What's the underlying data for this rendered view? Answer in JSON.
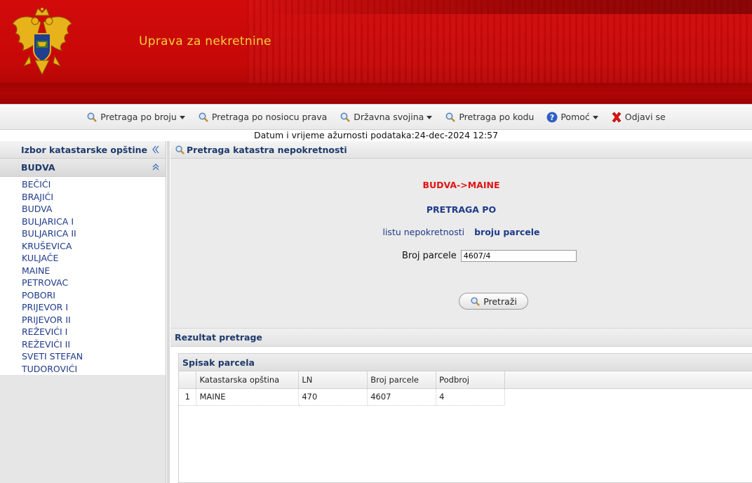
{
  "header": {
    "title": "Uprava za nekretnine"
  },
  "menu": {
    "items": [
      {
        "label": "Pretraga po broju",
        "icon": "search-icon",
        "dropdown": true
      },
      {
        "label": "Pretraga po nosiocu prava",
        "icon": "search-icon",
        "dropdown": false
      },
      {
        "label": "Državna svojina",
        "icon": "search-icon",
        "dropdown": true
      },
      {
        "label": "Pretraga po kodu",
        "icon": "search-icon",
        "dropdown": false
      },
      {
        "label": "Pomoć",
        "icon": "help-icon",
        "dropdown": true
      },
      {
        "label": "Odjavi se",
        "icon": "logout-icon",
        "dropdown": false
      }
    ]
  },
  "update_line": "Datum i vrijeme ažurnosti podataka:24-dec-2024 12:57",
  "sidebar": {
    "title": "Izbor katastarske opštine",
    "group": "BUDVA",
    "items": [
      "BEČIĆI",
      "BRAJIĆI",
      "BUDVA",
      "BULJARICA I",
      "BULJARICA II",
      "KRUŠEVICA",
      "KULJAČE",
      "MAINE",
      "PETROVAC",
      "POBORI",
      "PRIJEVOR I",
      "PRIJEVOR II",
      "REŽEVIĆI I",
      "REŽEVIĆI II",
      "SVETI STEFAN",
      "TUDOROVIĆI"
    ]
  },
  "search": {
    "panel_title": "Pretraga katastra nepokretnosti",
    "breadcrumb": "BUDVA->MAINE",
    "search_by": "PRETRAGA PO",
    "option_list": "listu nepokretnosti",
    "option_parcel": "broju parcele",
    "field_label": "Broj parcele",
    "field_value": "4607/4",
    "button_label": "Pretraži"
  },
  "results": {
    "title": "Rezultat pretrage",
    "list_title": "Spisak parcela",
    "columns": [
      "",
      "Katastarska opština",
      "LN",
      "Broj parcele",
      "Podbroj"
    ],
    "rows": [
      [
        "1",
        "MAINE",
        "470",
        "4607",
        "4"
      ]
    ]
  },
  "colors": {
    "header_red": "#c70808",
    "title_yellow": "#f2d23a",
    "link_blue": "#1d3a8a",
    "breadcrumb_red": "#e01414"
  }
}
